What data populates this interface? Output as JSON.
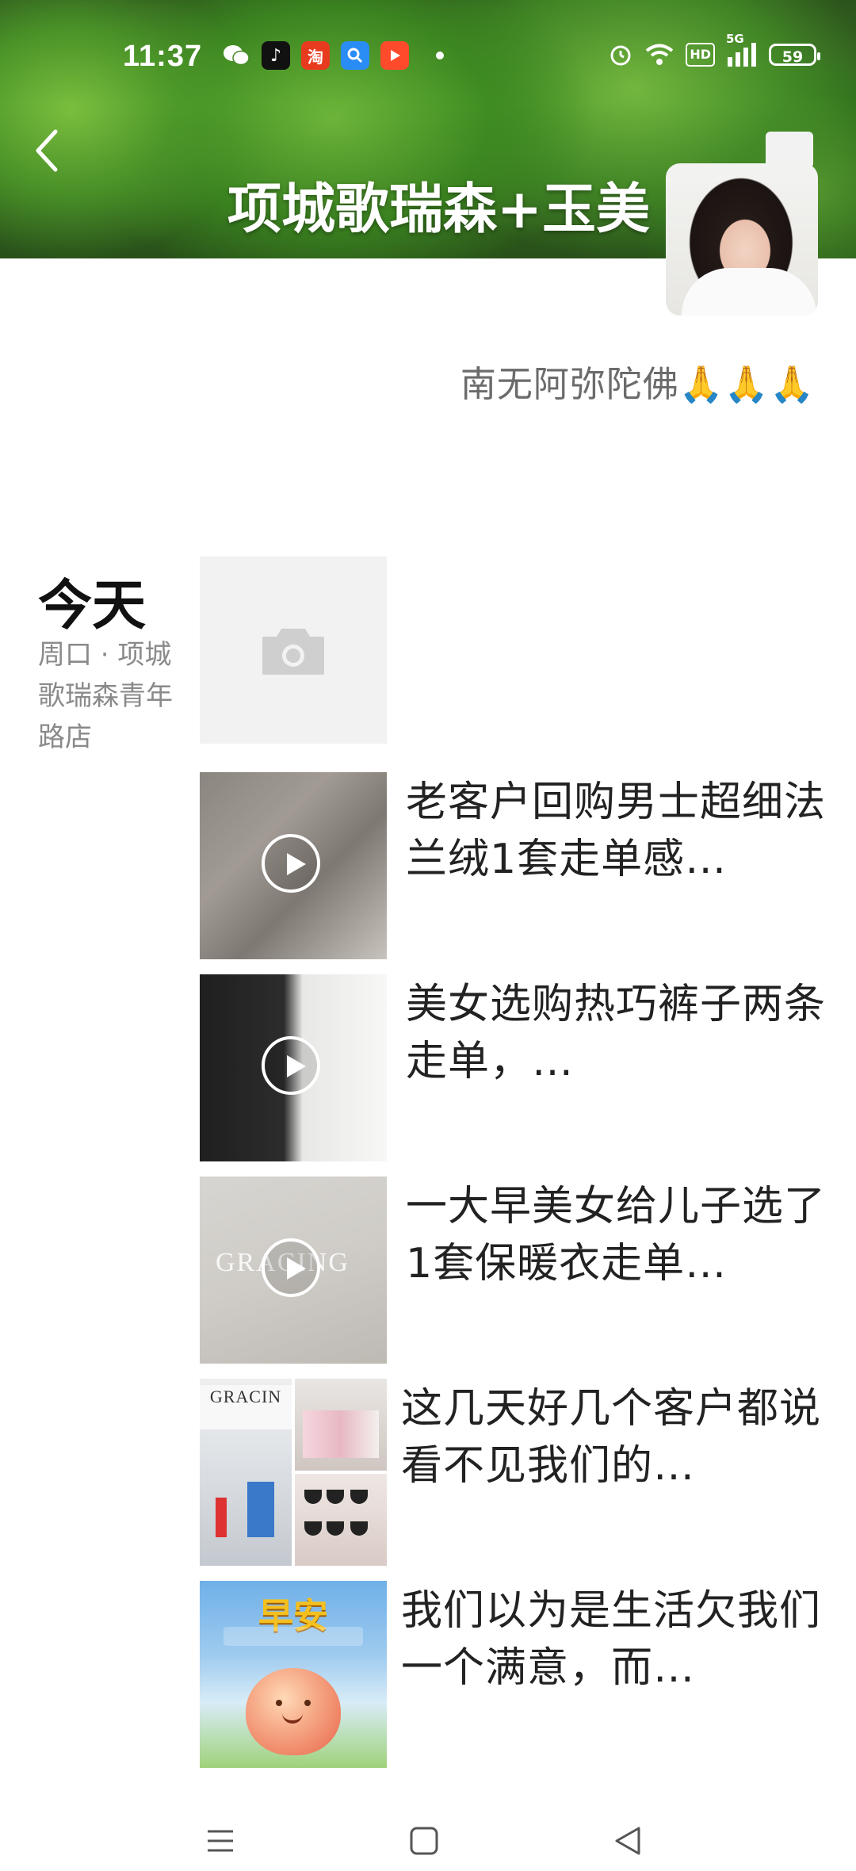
{
  "status_bar": {
    "time": "11:37",
    "notification_icons": [
      "wechat-icon",
      "tiktok-icon",
      "taobao-icon",
      "search-app-icon",
      "video-app-icon"
    ],
    "taobao_glyph": "淘",
    "hd_label": "HD",
    "network_label": "5G",
    "battery_level": "59"
  },
  "header": {
    "profile_name": "项城歌瑞森+玉美"
  },
  "profile": {
    "signature": "南无阿弥陀佛🙏🙏🙏"
  },
  "moments": {
    "day_label": "今天",
    "location": "周口 · 项城歌瑞森青年路店",
    "posts": [
      {
        "type": "video",
        "text": "老客户回购男士超细法兰绒1套走单感…"
      },
      {
        "type": "video",
        "text": "美女选购热巧裤子两条走单，…"
      },
      {
        "type": "video",
        "text": "一大早美女给儿子选了1套保暖衣走单…",
        "thumb_brand": "GRACING"
      },
      {
        "type": "images",
        "text": "这几天好几个客户都说看不见我们的…",
        "thumb_sign": "GRACIN"
      },
      {
        "type": "image",
        "text": "我们以为是生活欠我们一个满意，而…",
        "thumb_title": "早安"
      }
    ]
  },
  "colors": {
    "text_primary": "#222222",
    "text_secondary": "#8a8a8a",
    "signature": "#6b6b6b"
  }
}
